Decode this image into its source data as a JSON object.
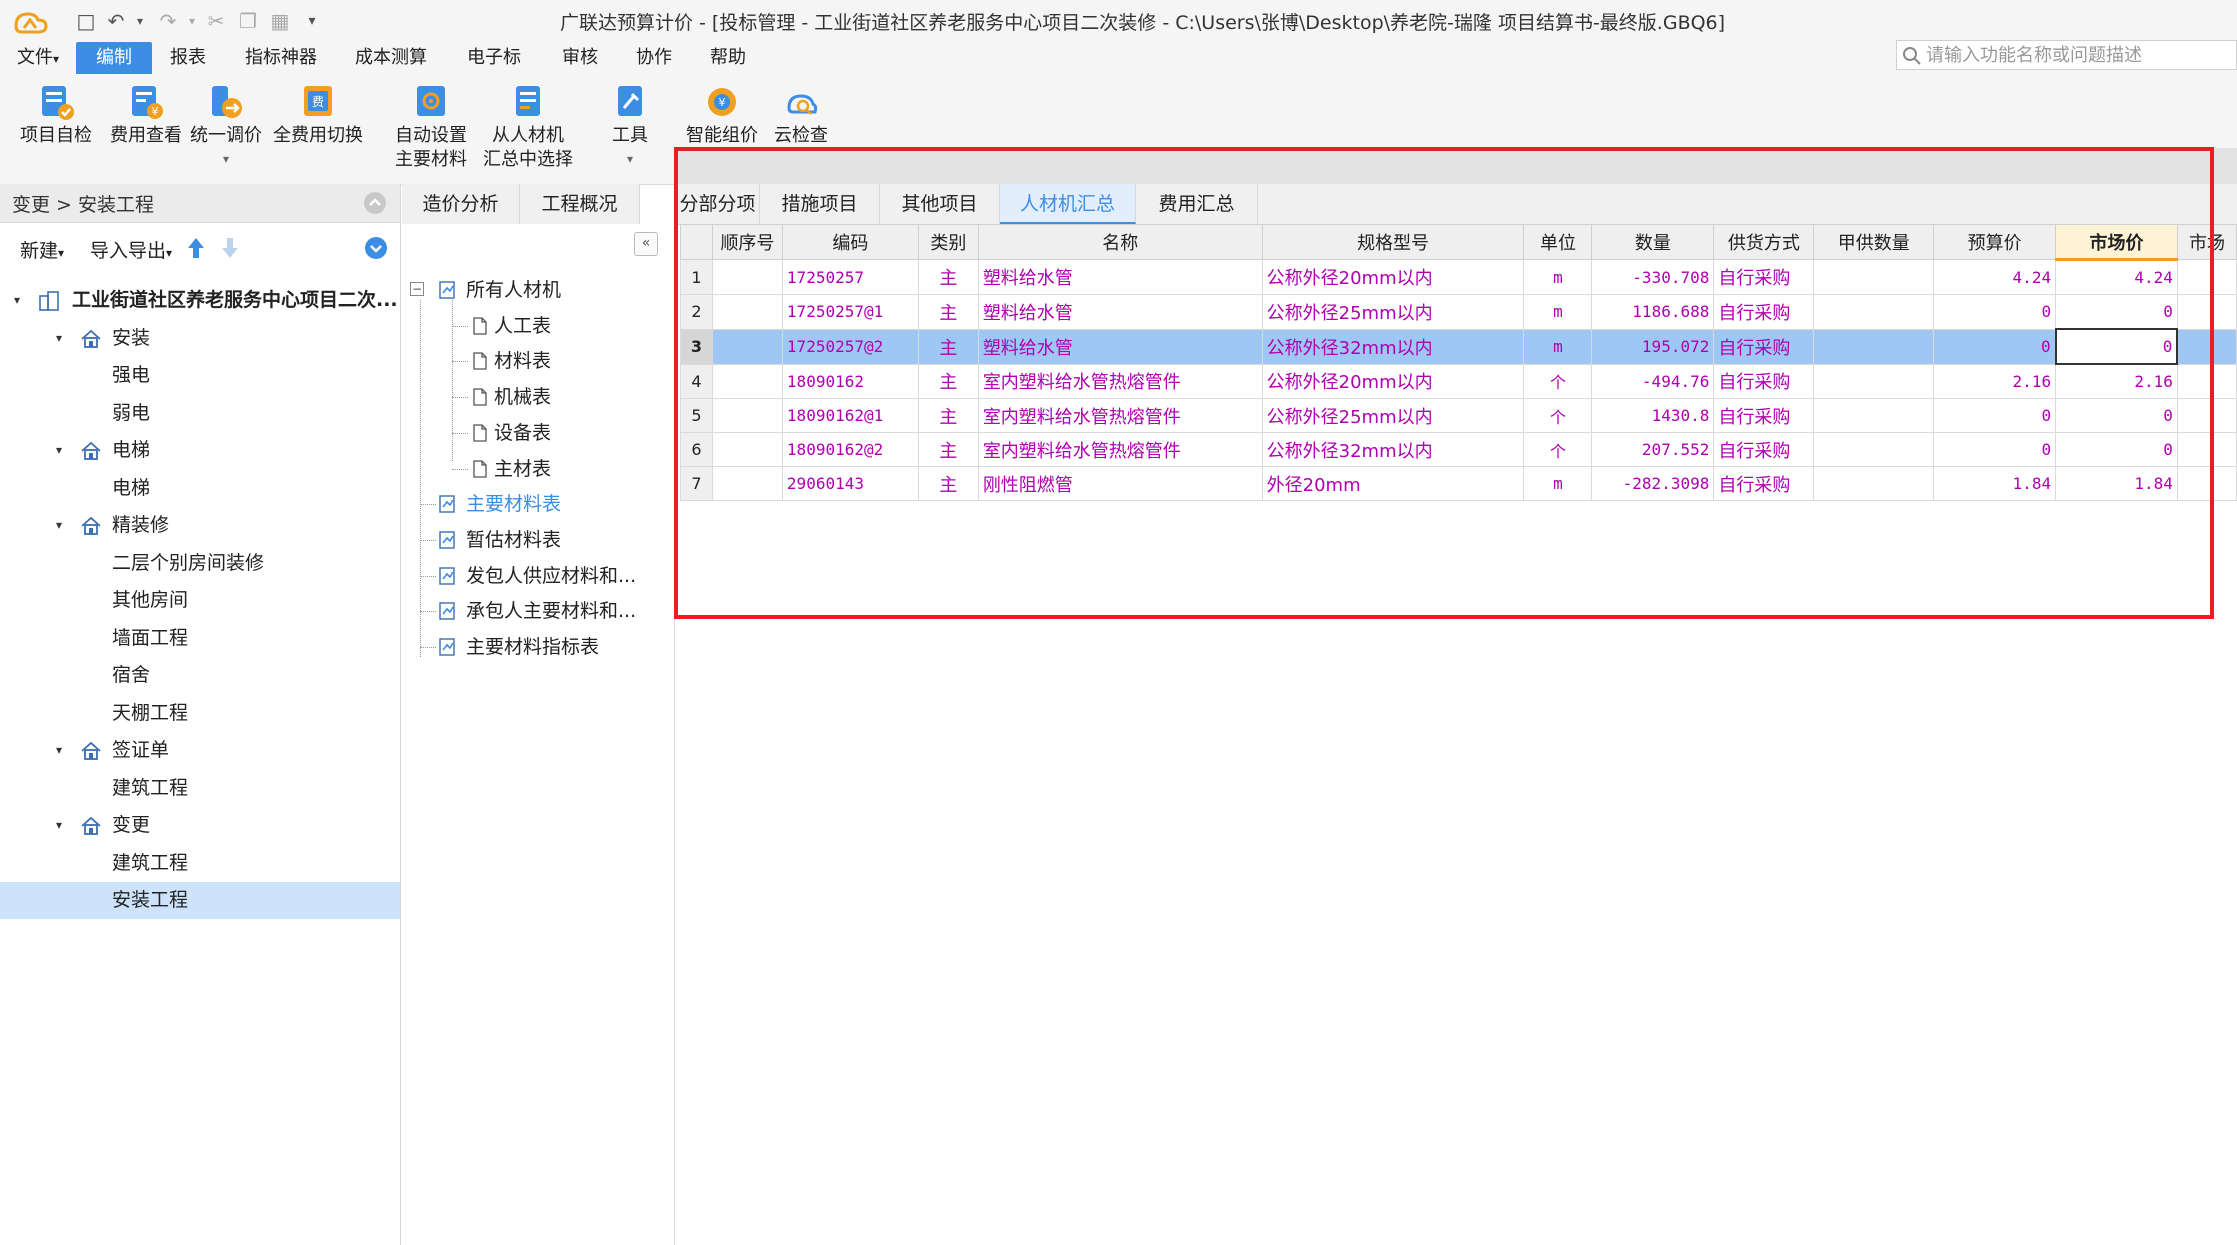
{
  "window": {
    "title": "广联达预算计价 - [投标管理 - 工业街道社区养老服务中心项目二次装修 - C:\\Users\\张博\\Desktop\\养老院-瑞隆 项目结算书-最终版.GBQ6]"
  },
  "menu": {
    "items": [
      "文件",
      "编制",
      "报表",
      "指标神器",
      "成本测算",
      "电子标",
      "审核",
      "协作",
      "帮助"
    ],
    "active_index": 1,
    "dropdown_marks": [
      "▾"
    ]
  },
  "search": {
    "placeholder": "请输入功能名称或问题描述"
  },
  "ribbon": {
    "buttons": [
      {
        "label": "项目自检",
        "icon": "checklist-icon"
      },
      {
        "label": "费用查看",
        "icon": "fee-view-icon"
      },
      {
        "label": "统一调价",
        "icon": "adjust-price-icon",
        "dropdown": true
      },
      {
        "label": "全费用切换",
        "icon": "full-cost-switch-icon"
      },
      {
        "label": "自动设置\n主要材料",
        "line1": "自动设置",
        "line2": "主要材料",
        "icon": "auto-set-material-icon"
      },
      {
        "label": "从人材机\n汇总中选择",
        "line1": "从人材机",
        "line2": "汇总中选择",
        "icon": "select-from-summary-icon"
      },
      {
        "label": "工具",
        "icon": "tools-icon",
        "dropdown": true
      },
      {
        "label": "智能组价",
        "icon": "smart-pricing-icon"
      },
      {
        "label": "云检查",
        "icon": "cloud-check-icon"
      }
    ]
  },
  "left_panel": {
    "breadcrumb": "变更 > 安装工程",
    "tools": {
      "new": "新建",
      "import_export": "导入导出"
    },
    "tree": [
      {
        "label": "工业街道社区养老服务中心项目二次...",
        "level": 0,
        "type": "project"
      },
      {
        "label": "安装",
        "level": 1,
        "type": "folder"
      },
      {
        "label": "强电",
        "level": 2
      },
      {
        "label": "弱电",
        "level": 2
      },
      {
        "label": "电梯",
        "level": 1,
        "type": "folder"
      },
      {
        "label": "电梯",
        "level": 2
      },
      {
        "label": "精装修",
        "level": 1,
        "type": "folder"
      },
      {
        "label": "二层个别房间装修",
        "level": 2
      },
      {
        "label": "其他房间",
        "level": 2
      },
      {
        "label": "墙面工程",
        "level": 2
      },
      {
        "label": "宿舍",
        "level": 2
      },
      {
        "label": "天棚工程",
        "level": 2
      },
      {
        "label": "签证单",
        "level": 1,
        "type": "folder"
      },
      {
        "label": "建筑工程",
        "level": 2
      },
      {
        "label": "变更",
        "level": 1,
        "type": "folder"
      },
      {
        "label": "建筑工程",
        "level": 2
      },
      {
        "label": "安装工程",
        "level": 2,
        "selected": true
      }
    ]
  },
  "middle_panel": {
    "tabs": [
      "造价分析",
      "工程概况"
    ],
    "tree": [
      {
        "label": "所有人材机",
        "level": 0
      },
      {
        "label": "人工表",
        "level": 1
      },
      {
        "label": "材料表",
        "level": 1
      },
      {
        "label": "机械表",
        "level": 1
      },
      {
        "label": "设备表",
        "level": 1
      },
      {
        "label": "主材表",
        "level": 1
      },
      {
        "label": "主要材料表",
        "level": 0,
        "active": true
      },
      {
        "label": "暂估材料表",
        "level": 0
      },
      {
        "label": "发包人供应材料和...",
        "level": 0
      },
      {
        "label": "承包人主要材料和...",
        "level": 0
      },
      {
        "label": "主要材料指标表",
        "level": 0
      }
    ]
  },
  "main_tabs": {
    "items": [
      "分部分项",
      "措施项目",
      "其他项目",
      "人材机汇总",
      "费用汇总"
    ],
    "active_index": 3
  },
  "grid": {
    "columns": [
      "",
      "顺序号",
      "编码",
      "类别",
      "名称",
      "规格型号",
      "单位",
      "数量",
      "供货方式",
      "甲供数量",
      "预算价",
      "市场价",
      "市场"
    ],
    "sorted_column": 11,
    "rows": [
      {
        "idx": "1",
        "seq": "",
        "code": "17250257",
        "cat": "主",
        "name": "塑料给水管",
        "spec": "公称外径20mm以内",
        "unit": "m",
        "qty": "-330.708",
        "supply": "自行采购",
        "owner_qty": "",
        "budget": "4.24",
        "market": "4.24"
      },
      {
        "idx": "2",
        "seq": "",
        "code": "17250257@1",
        "cat": "主",
        "name": "塑料给水管",
        "spec": "公称外径25mm以内",
        "unit": "m",
        "qty": "1186.688",
        "supply": "自行采购",
        "owner_qty": "",
        "budget": "0",
        "market": "0"
      },
      {
        "idx": "3",
        "seq": "",
        "code": "17250257@2",
        "cat": "主",
        "name": "塑料给水管",
        "spec": "公称外径32mm以内",
        "unit": "m",
        "qty": "195.072",
        "supply": "自行采购",
        "owner_qty": "",
        "budget": "0",
        "market": "0",
        "selected": true
      },
      {
        "idx": "4",
        "seq": "",
        "code": "18090162",
        "cat": "主",
        "name": "室内塑料给水管热熔管件",
        "spec": "公称外径20mm以内",
        "unit": "个",
        "qty": "-494.76",
        "supply": "自行采购",
        "owner_qty": "",
        "budget": "2.16",
        "market": "2.16"
      },
      {
        "idx": "5",
        "seq": "",
        "code": "18090162@1",
        "cat": "主",
        "name": "室内塑料给水管热熔管件",
        "spec": "公称外径25mm以内",
        "unit": "个",
        "qty": "1430.8",
        "supply": "自行采购",
        "owner_qty": "",
        "budget": "0",
        "market": "0"
      },
      {
        "idx": "6",
        "seq": "",
        "code": "18090162@2",
        "cat": "主",
        "name": "室内塑料给水管热熔管件",
        "spec": "公称外径32mm以内",
        "unit": "个",
        "qty": "207.552",
        "supply": "自行采购",
        "owner_qty": "",
        "budget": "0",
        "market": "0"
      },
      {
        "idx": "7",
        "seq": "",
        "code": "29060143",
        "cat": "主",
        "name": "刚性阻燃管",
        "spec": "外径20mm",
        "unit": "m",
        "qty": "-282.3098",
        "supply": "自行采购",
        "owner_qty": "",
        "budget": "1.84",
        "market": "1.84"
      }
    ]
  },
  "colors": {
    "accent": "#3c8ee5",
    "highlight_frame": "#ec1c24",
    "cell_text": "#b000b0",
    "selected_row": "#9ec8f3"
  }
}
